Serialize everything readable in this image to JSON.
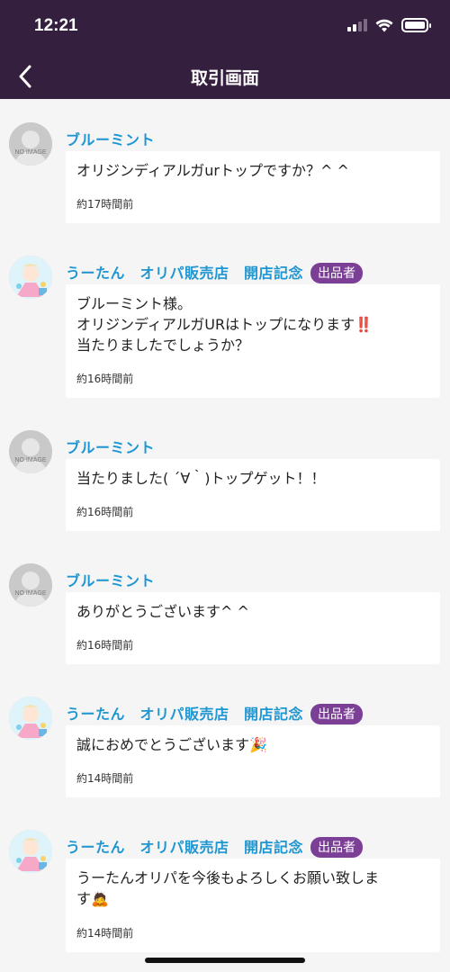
{
  "status_bar": {
    "time": "12:21"
  },
  "nav": {
    "title": "取引画面",
    "back_icon": "chevron-left-icon"
  },
  "colors": {
    "header_bg": "#351f3e",
    "name_blue": "#1e96d2",
    "badge_purple": "#7b3f96"
  },
  "messages": [
    {
      "sender": "ブルーミント",
      "avatar": "no-image",
      "avatar_text": "NO IMAGE",
      "text": "オリジンディアルガurトップですか？^ ^",
      "time": "約17時間前"
    },
    {
      "sender": "うーたん　オリパ販売店　開店記念",
      "avatar": "character",
      "badge": "出品者",
      "text": "ブルーミント様。\nオリジンディアルガURはトップになります‼️\n当たりましたでしょうか？",
      "time": "約16時間前"
    },
    {
      "sender": "ブルーミント",
      "avatar": "no-image",
      "avatar_text": "NO IMAGE",
      "text": "当たりました( ´∀｀)トップゲット！！",
      "time": "約16時間前"
    },
    {
      "sender": "ブルーミント",
      "avatar": "no-image",
      "avatar_text": "NO IMAGE",
      "text": "ありがとうございます^ ^",
      "time": "約16時間前"
    },
    {
      "sender": "うーたん　オリパ販売店　開店記念",
      "avatar": "character",
      "badge": "出品者",
      "text": "誠におめでとうございます🎉",
      "time": "約14時間前"
    },
    {
      "sender": "うーたん　オリパ販売店　開店記念",
      "avatar": "character",
      "badge": "出品者",
      "text": "うーたんオリパを今後もよろしくお願い致しま\nす🙇",
      "time": "約14時間前"
    }
  ]
}
